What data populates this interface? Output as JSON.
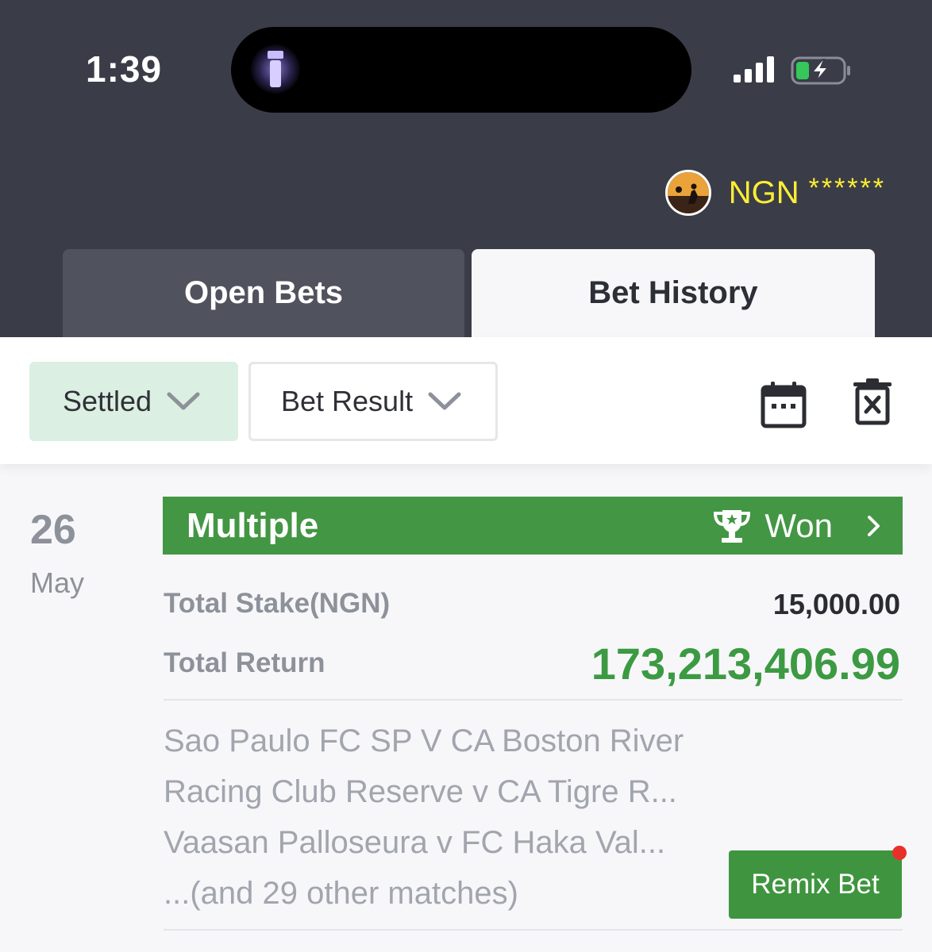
{
  "status_bar": {
    "time": "1:39"
  },
  "account": {
    "currency": "NGN",
    "balance_masked": "******"
  },
  "tabs": [
    {
      "label": "Open Bets",
      "active": false
    },
    {
      "label": "Bet History",
      "active": true
    }
  ],
  "filters": {
    "status_dropdown": "Settled",
    "result_dropdown": "Bet Result"
  },
  "bet": {
    "day": "26",
    "month": "May",
    "type": "Multiple",
    "result": "Won",
    "total_stake_label": "Total Stake(NGN)",
    "total_stake_value": "15,000.00",
    "total_return_label": "Total Return",
    "total_return_value": "173,213,406.99",
    "matches": [
      "Sao Paulo FC SP V CA Boston River",
      "Racing Club Reserve v CA Tigre R...",
      "Vaasan Palloseura v FC Haka Val...",
      "...(and 29 other matches)"
    ],
    "remix_label": "Remix Bet"
  },
  "colors": {
    "header_bg": "#3a3d48",
    "won_green": "#439643",
    "return_green": "#3c9a43",
    "balance_yellow": "#ffee33",
    "settled_chip_bg": "#dcefe3"
  }
}
